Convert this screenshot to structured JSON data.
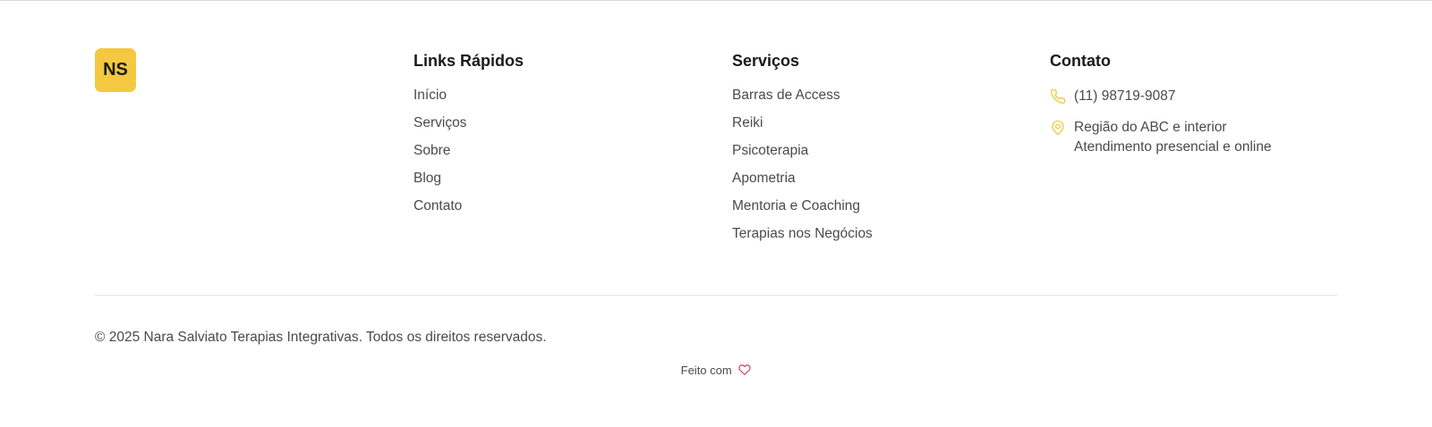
{
  "brand": {
    "logo_text": "NS",
    "accent_color": "#f5c842"
  },
  "quick_links": {
    "title": "Links Rápidos",
    "items": [
      "Início",
      "Serviços",
      "Sobre",
      "Blog",
      "Contato"
    ]
  },
  "services": {
    "title": "Serviços",
    "items": [
      "Barras de Access",
      "Reiki",
      "Psicoterapia",
      "Apometria",
      "Mentoria e Coaching",
      "Terapias nos Negócios"
    ]
  },
  "contact": {
    "title": "Contato",
    "phone": "(11) 98719-9087",
    "phone_icon": "phone-icon",
    "address_line1": "Região do ABC e interior",
    "address_line2": "Atendimento presencial e online",
    "address_icon": "map-pin-icon"
  },
  "footer_bottom": {
    "copyright": "© 2025 Nara Salviato Terapias Integrativas. Todos os direitos reservados.",
    "made_with": "Feito com",
    "made_with_icon": "heart-icon",
    "heart_color": "#d63b5a"
  }
}
